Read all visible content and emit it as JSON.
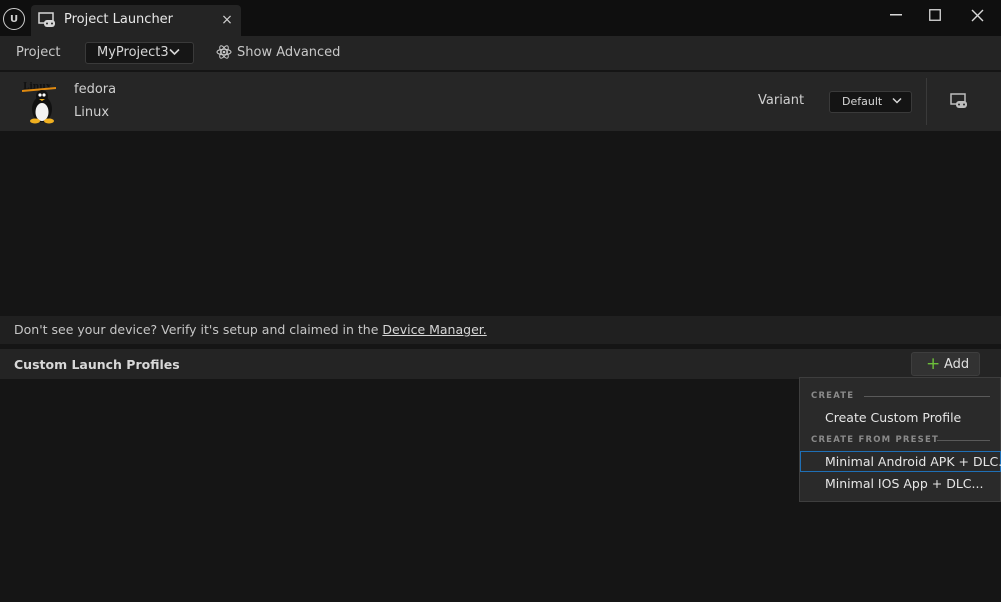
{
  "window": {
    "tab_title": "Project Launcher",
    "tab_close": "×"
  },
  "toolbar": {
    "project_label": "Project",
    "project_value": "MyProject3",
    "show_advanced": "Show Advanced"
  },
  "device": {
    "name": "fedora",
    "os": "Linux",
    "icon_label": "Linux",
    "variant_label": "Variant",
    "variant_value": "Default"
  },
  "hint": {
    "text": "Don't see your device? Verify it's setup and claimed in the ",
    "link": "Device Manager."
  },
  "profiles": {
    "title": "Custom Launch Profiles",
    "add_label": "Add"
  },
  "menu": {
    "section_create": "CREATE",
    "create_custom": "Create Custom Profile",
    "section_preset": "CREATE FROM PRESET",
    "preset_android": "Minimal Android APK + DLC...",
    "preset_ios": "Minimal IOS App + DLC..."
  },
  "colors": {
    "accent_add": "#6cbf3a",
    "menu_hover_border": "#1f6fb5"
  }
}
